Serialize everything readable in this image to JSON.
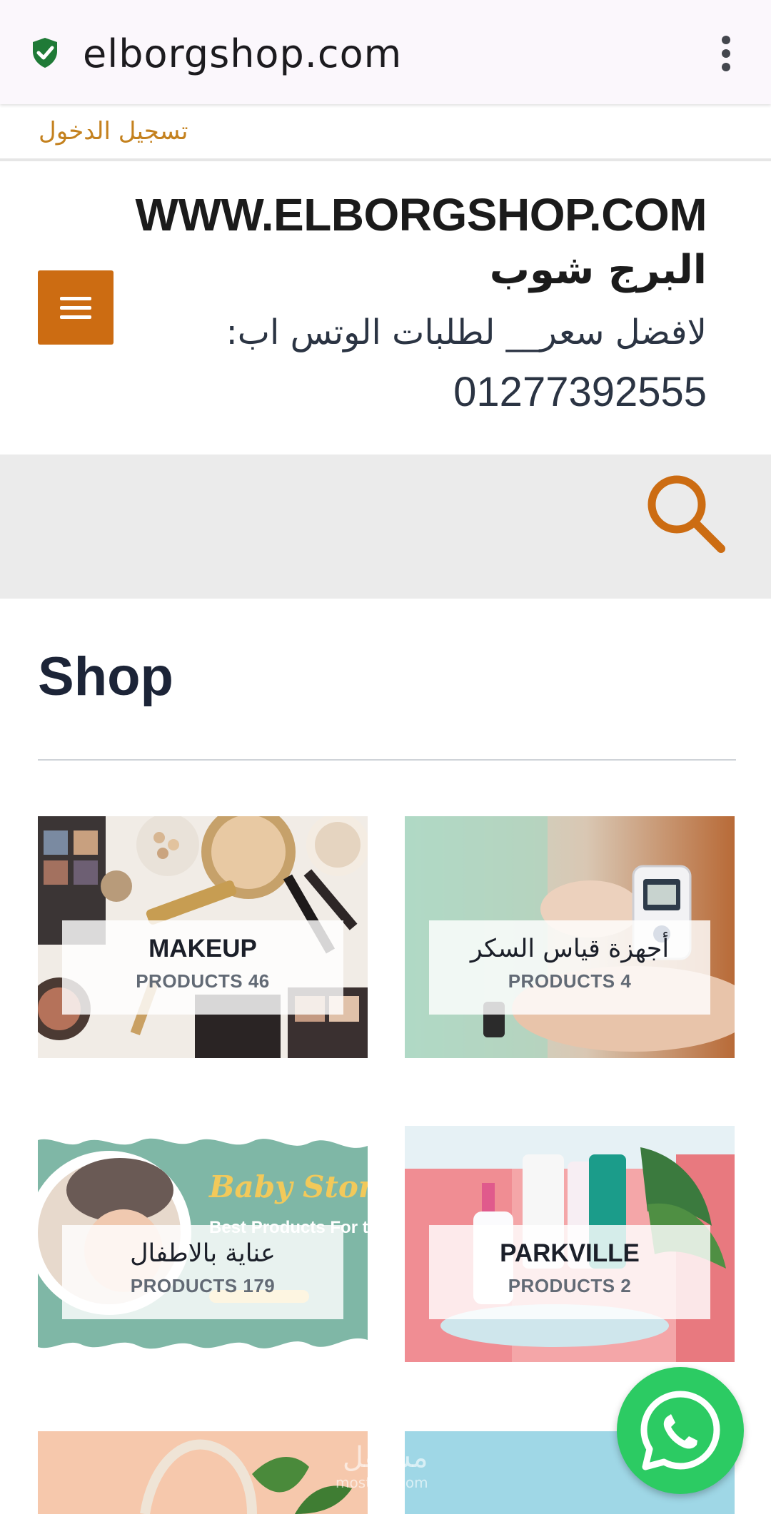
{
  "browser": {
    "url": "elborgshop.com",
    "security_icon": "shield-check-icon",
    "menu_icon": "kebab-menu-icon"
  },
  "topbar": {
    "login_label": "تسجيل الدخول"
  },
  "header": {
    "site_title": "WWW.ELBORGSHOP.COM",
    "site_name_ar": "البرج شوب",
    "tagline": "لافضل سعر__ لطلبات الوتس اب:",
    "phone": "01277392555",
    "menu_icon": "hamburger-icon"
  },
  "search": {
    "icon": "search-icon"
  },
  "shop": {
    "title": "Shop",
    "categories": [
      {
        "name": "MAKEUP",
        "count": "PRODUCTS 46"
      },
      {
        "name": "أجهزة قياس السكر",
        "count": "PRODUCTS 4"
      },
      {
        "name": "عناية بالاطفال",
        "count": "PRODUCTS 179"
      },
      {
        "name": "PARKVILLE",
        "count": "PRODUCTS 2"
      }
    ],
    "baby_banner": {
      "title": "Baby Store",
      "subtitle": "Best Products For the Little One"
    }
  },
  "whatsapp": {
    "icon": "whatsapp-icon"
  },
  "watermark": {
    "text": "مستقل",
    "sub": "mostaql.com"
  },
  "colors": {
    "accent": "#cc6c12",
    "whatsapp": "#2ccb63",
    "login": "#c4811e"
  }
}
